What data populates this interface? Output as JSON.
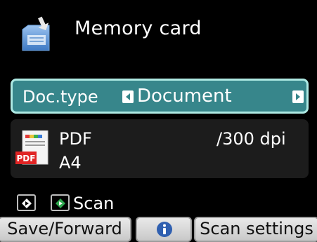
{
  "header": {
    "title": "Memory card",
    "icon": "memory-card-save-icon"
  },
  "doc_type": {
    "label": "Doc.type",
    "value": "Document",
    "left_arrow_icon": "left-arrow-icon",
    "right_arrow_icon": "right-arrow-icon"
  },
  "format": {
    "icon": "pdf-file-icon",
    "icon_badge": "PDF",
    "type": "PDF",
    "resolution": "/300 dpi",
    "size": "A4"
  },
  "scan": {
    "label": "Scan",
    "black_key_icon": "black-start-icon",
    "color_key_icon": "color-start-icon"
  },
  "softkeys": {
    "left_label": "Save/Forward",
    "middle_icon": "info-icon",
    "right_label": "Scan settings"
  },
  "colors": {
    "background": "#000000",
    "selected_row": "#37868b",
    "selected_border": "#aee9e3",
    "panel": "#1c1c1c",
    "softkey": "#dcdcdc",
    "color_key_accent": "#2fa84f",
    "info_accent": "#2f5fb0"
  }
}
